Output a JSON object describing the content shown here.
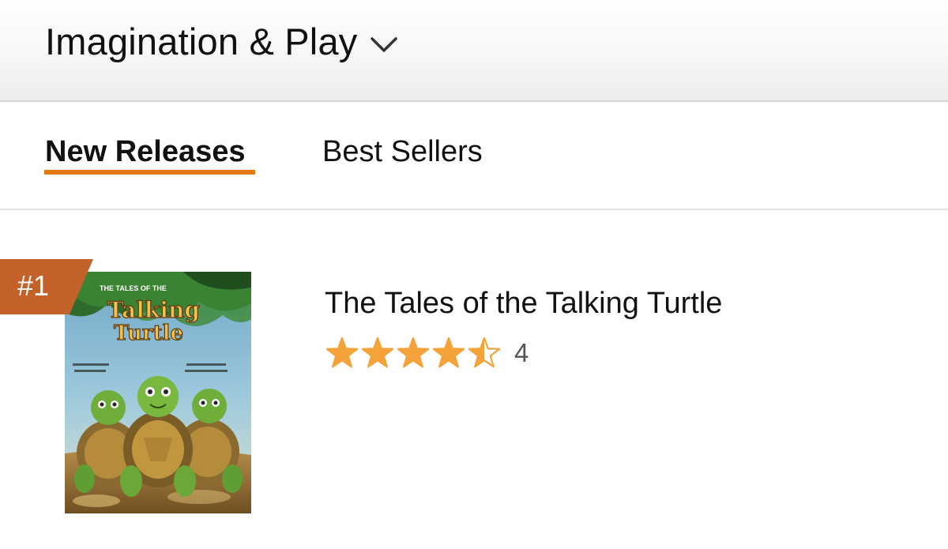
{
  "header": {
    "category_title": "Imagination & Play",
    "dropdown_icon": "chevron-down-icon"
  },
  "tabs": [
    {
      "label": "New Releases",
      "active": true
    },
    {
      "label": "Best Sellers",
      "active": false
    }
  ],
  "colors": {
    "active_tab_underline": "#e47911",
    "rank_badge": "#c4622c",
    "star": "#f3a33a"
  },
  "product": {
    "rank": "#1",
    "cover_title_line1": "THE TALES OF THE",
    "cover_title_line2": "Talking",
    "cover_title_line3": "Turtle",
    "title": "The Tales of the Talking Turtle",
    "rating": 4.5,
    "rating_max": 5,
    "review_count": "4"
  }
}
